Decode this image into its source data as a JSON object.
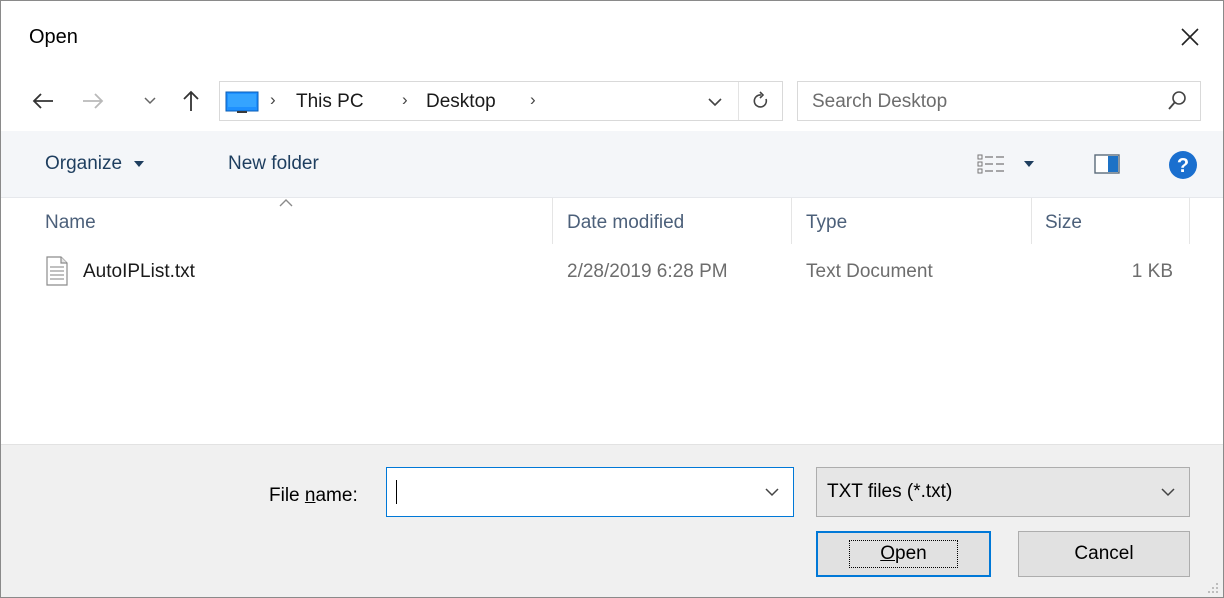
{
  "window": {
    "title": "Open"
  },
  "nav": {
    "breadcrumbs": [
      "This PC",
      "Desktop"
    ]
  },
  "search": {
    "placeholder": "Search Desktop"
  },
  "toolbar": {
    "organize_label": "Organize",
    "new_folder_label": "New folder"
  },
  "columns": [
    "Name",
    "Date modified",
    "Type",
    "Size"
  ],
  "files": [
    {
      "name": "AutoIPList.txt",
      "date_modified": "2/28/2019 6:28 PM",
      "type": "Text Document",
      "size": "1 KB"
    }
  ],
  "bottom": {
    "file_name_label_pre": "File ",
    "file_name_label_u": "n",
    "file_name_label_post": "ame:",
    "file_name_value": "",
    "file_type_selected": "TXT files (*.txt)",
    "open_label_u": "O",
    "open_label_rest": "pen",
    "cancel_label": "Cancel"
  },
  "colors": {
    "accent": "#0078d7",
    "command_text": "#1e3e5f",
    "header_text": "#4c607a",
    "help_blue": "#1a6fcf"
  },
  "icons": [
    "close-icon",
    "back-icon",
    "forward-icon",
    "recent-locations-icon",
    "up-icon",
    "this-pc-icon",
    "chevron-down-icon",
    "refresh-icon",
    "search-icon",
    "view-options-icon",
    "preview-pane-icon",
    "help-icon",
    "text-file-icon",
    "resize-grip-icon"
  ]
}
